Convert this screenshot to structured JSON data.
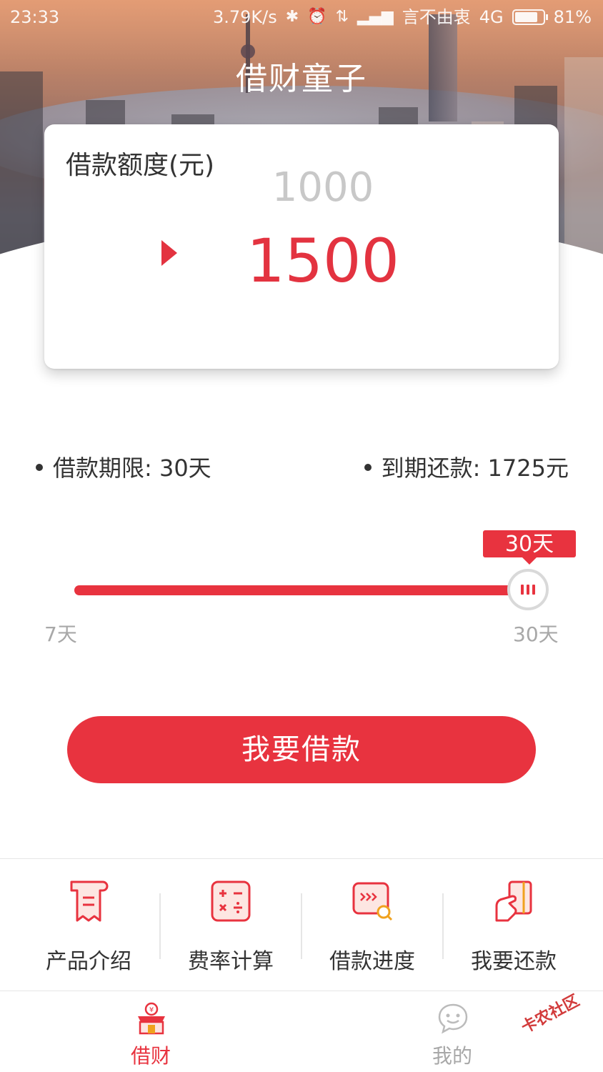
{
  "status_bar": {
    "time": "23:33",
    "speed": "3.79K/s",
    "carrier": "言不由衷",
    "network": "4G",
    "battery": "81%",
    "battery_level": 0.81,
    "icons": [
      "bluetooth-icon",
      "alarm-icon",
      "data-arrows-icon",
      "signal-icon"
    ]
  },
  "header": {
    "title": "借财童子"
  },
  "amount_card": {
    "label": "借款额度(元)",
    "prev_amount": "1000",
    "current_amount": "1500"
  },
  "loan_info": {
    "term_label": "借款期限: 30天",
    "repay_label": "到期还款: 1725元"
  },
  "term_slider": {
    "tooltip": "30天",
    "min_label": "7天",
    "max_label": "30天",
    "min_days": 7,
    "max_days": 30,
    "value_days": 30
  },
  "borrow_button": {
    "label": "我要借款"
  },
  "quick_actions": [
    {
      "label": "产品介绍",
      "icon": "receipt-icon"
    },
    {
      "label": "费率计算",
      "icon": "calculator-icon"
    },
    {
      "label": "借款进度",
      "icon": "progress-search-icon"
    },
    {
      "label": "我要还款",
      "icon": "card-hand-icon"
    }
  ],
  "bottom_nav": {
    "items": [
      {
        "label": "借财",
        "icon": "store-icon",
        "active": true
      },
      {
        "label": "我的",
        "icon": "chat-face-icon",
        "active": false
      }
    ]
  },
  "watermark": "卡农社区",
  "colors": {
    "accent": "#e8333f",
    "text": "#333333",
    "muted": "#a8a8a8"
  }
}
